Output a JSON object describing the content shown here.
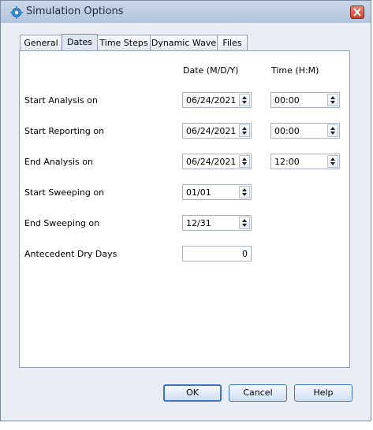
{
  "window": {
    "title": "Simulation Options",
    "app_icon": "simulation-gear-icon",
    "close_icon": "close-icon"
  },
  "tabs": [
    {
      "label": "General",
      "active": false
    },
    {
      "label": "Dates",
      "active": true
    },
    {
      "label": "Time Steps",
      "active": false
    },
    {
      "label": "Dynamic Wave",
      "active": false
    },
    {
      "label": "Files",
      "active": false
    }
  ],
  "columns": {
    "date": "Date (M/D/Y)",
    "time": "Time (H:M)"
  },
  "rows": {
    "start_analysis": {
      "label": "Start Analysis on",
      "date": "06/24/2021",
      "time": "00:00"
    },
    "start_reporting": {
      "label": "Start Reporting on",
      "date": "06/24/2021",
      "time": "00:00"
    },
    "end_analysis": {
      "label": "End Analysis on",
      "date": "06/24/2021",
      "time": "12:00"
    },
    "start_sweeping": {
      "label": "Start Sweeping on",
      "date": "01/01"
    },
    "end_sweeping": {
      "label": "End Sweeping on",
      "date": "12/31"
    },
    "antecedent_dry_days": {
      "label": "Antecedent Dry Days",
      "value": "0"
    }
  },
  "buttons": {
    "ok": "OK",
    "cancel": "Cancel",
    "help": "Help"
  },
  "colors": {
    "titlebar": "#c3d2e6",
    "button_border": "#3d72c4",
    "close_button": "#c8432e"
  }
}
